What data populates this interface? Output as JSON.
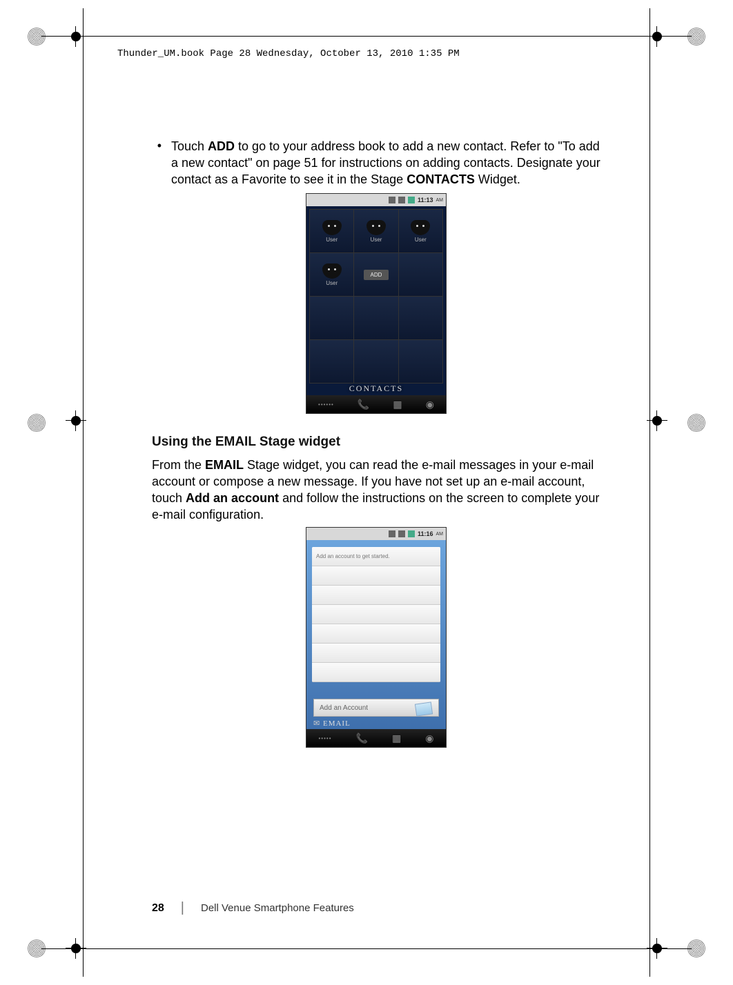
{
  "header": {
    "meta_line": "Thunder_UM.book  Page 28  Wednesday, October 13, 2010  1:35 PM"
  },
  "body": {
    "bullet1_pre": "Touch ",
    "bullet1_bold1": "ADD",
    "bullet1_mid": " to go to your address book to add a new contact. Refer to \"To add a new contact\" on page 51 for instructions on adding contacts. Designate your contact as a Favorite to see it in the Stage ",
    "bullet1_bold2": "CONTACTS",
    "bullet1_post": " Widget.",
    "heading": "Using the EMAIL Stage widget",
    "para_pre": "From the ",
    "para_b1": "EMAIL",
    "para_mid1": " Stage widget, you can read the e-mail messages in your e-mail account or compose a new message. If you have not set up an e-mail account, touch ",
    "para_b2": "Add an account",
    "para_mid2": " and follow the instructions on the screen to complete your e-mail configuration."
  },
  "contacts_shot": {
    "time": "11:13",
    "ampm": "AM",
    "user_label": "User",
    "add_label": "ADD",
    "widget_title": "CONTACTS"
  },
  "email_shot": {
    "time": "11:16",
    "ampm": "AM",
    "prompt": "Add an account to get started.",
    "add_account": "Add an Account",
    "widget_title": "EMAIL"
  },
  "footer": {
    "page_number": "28",
    "title": "Dell Venue Smartphone Features"
  }
}
